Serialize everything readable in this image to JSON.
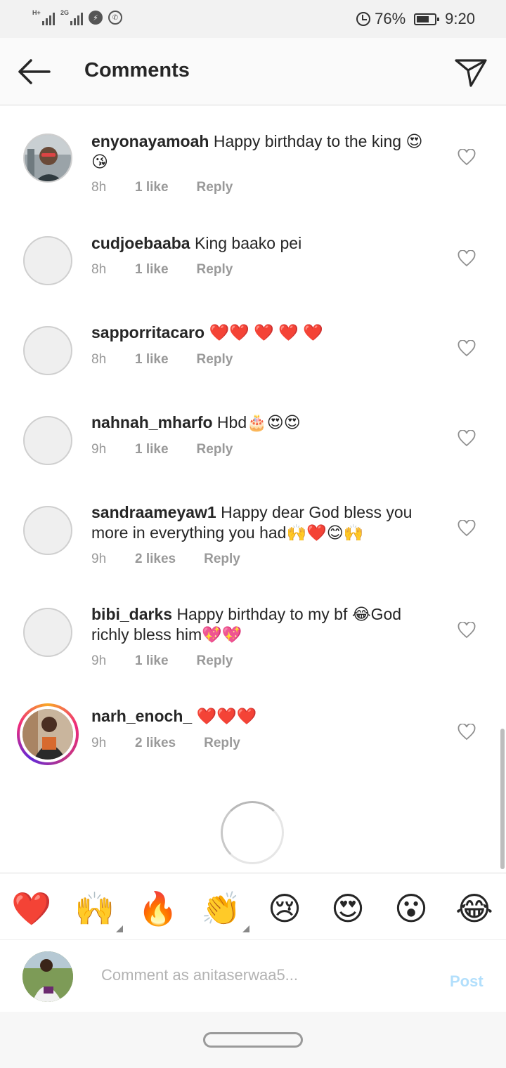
{
  "status_bar": {
    "net1_tag": "H+",
    "net2_tag": "2G",
    "battery_text": "76%",
    "battery_level": 0.76,
    "time": "9:20"
  },
  "header": {
    "title": "Comments"
  },
  "comments": [
    {
      "username": "enyonayamoah",
      "text": "Happy birthday to the king 😍😘",
      "time": "8h",
      "likes": "1 like",
      "reply": "Reply"
    },
    {
      "username": "cudjoebaaba",
      "text": "King baako pei",
      "time": "8h",
      "likes": "1 like",
      "reply": "Reply"
    },
    {
      "username": "sapporritacaro",
      "text": "❤️❤️ ❤️ ❤️ ❤️",
      "time": "8h",
      "likes": "1 like",
      "reply": "Reply"
    },
    {
      "username": "nahnah_mharfo",
      "text": "Hbd🎂😍😍",
      "time": "9h",
      "likes": "1 like",
      "reply": "Reply"
    },
    {
      "username": "sandraameyaw1",
      "text": "Happy dear God bless you more in everything you had🙌❤️😊🙌",
      "time": "9h",
      "likes": "2 likes",
      "reply": "Reply"
    },
    {
      "username": "bibi_darks",
      "text": "Happy birthday to my bf 😂God richly bless him💖💖",
      "time": "9h",
      "likes": "1 like",
      "reply": "Reply"
    },
    {
      "username": "narh_enoch_",
      "text": "❤️❤️❤️",
      "time": "9h",
      "likes": "2 likes",
      "reply": "Reply"
    }
  ],
  "reactions": [
    "❤️",
    "🙌",
    "🔥",
    "👏",
    "😢",
    "😍",
    "😮",
    "😂"
  ],
  "composer": {
    "placeholder": "Comment as anitaserwaa5...",
    "post_label": "Post"
  },
  "icons": {
    "back": "arrow-left-icon",
    "share": "paper-plane-icon",
    "like": "heart-outline-icon"
  },
  "colors": {
    "post_disabled": "#b2dffc",
    "story_ring": "#ee2a7b"
  }
}
